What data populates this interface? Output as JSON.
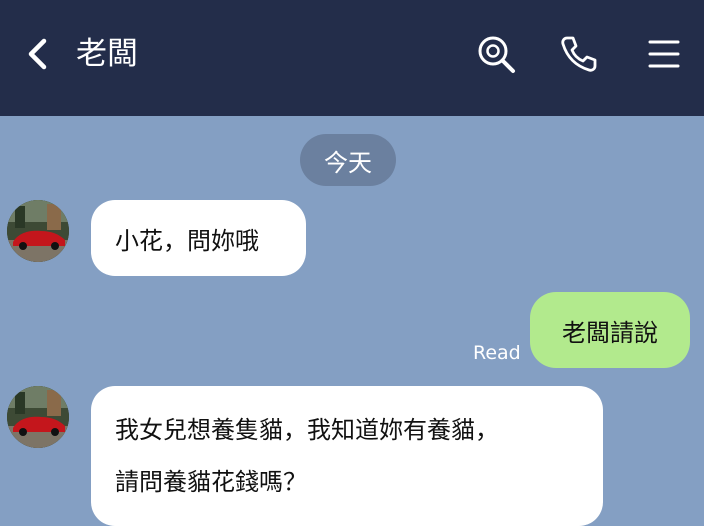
{
  "header": {
    "title": "老闆",
    "icons": [
      "back-arrow-icon",
      "search-icon",
      "phone-icon",
      "menu-icon"
    ]
  },
  "chat": {
    "date_label": "今天",
    "messages": [
      {
        "from": "other",
        "text": "小花，問妳哦"
      },
      {
        "from": "me",
        "text": "老闆請說",
        "status": "Read"
      },
      {
        "from": "other",
        "lines": [
          "我女兒想養隻貓，我知道妳有養貓，",
          "請問養貓花錢嗎？"
        ]
      }
    ]
  },
  "colors": {
    "header_bg": "#232d4a",
    "chat_bg": "#849fc3",
    "outgoing_bubble": "#b2ea8d",
    "incoming_bubble": "#ffffff",
    "date_pill": "#6b809f"
  }
}
